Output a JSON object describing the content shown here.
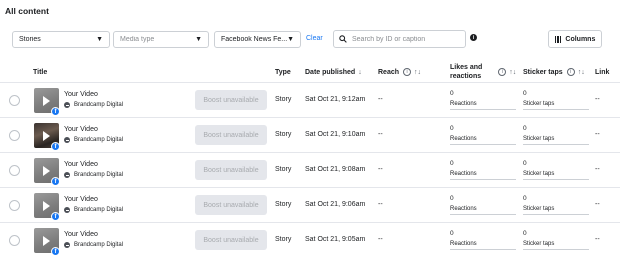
{
  "page": {
    "title": "All content"
  },
  "filters": {
    "type_select": "Stories",
    "media_type_placeholder": "Media type",
    "platform_select": "Facebook News Fe...",
    "clear_label": "Clear",
    "search_placeholder": "Search by ID or caption",
    "info_label": "i",
    "columns_label": "Columns"
  },
  "table": {
    "headers": {
      "title": "Title",
      "type": "Type",
      "date_published": "Date published",
      "date_sort": "↓",
      "reach": "Reach",
      "likes_reactions_line1": "Likes and",
      "likes_reactions_line2": "reactions",
      "sticker_taps": "Sticker taps",
      "link": "Link",
      "sort_glyph": "↑↓",
      "info_glyph": "i"
    },
    "rows": [
      {
        "title": "Your Video",
        "page": "Brandcamp Digital",
        "thumb": "gray",
        "boost": "Boost unavailable",
        "type": "Story",
        "date": "Sat Oct 21, 9:12am",
        "reach": "--",
        "reactions": "0",
        "reactions_label": "Reactions",
        "sticker_taps": "0",
        "sticker_label": "Sticker taps",
        "link": "--"
      },
      {
        "title": "Your Video",
        "page": "Brandcamp Digital",
        "thumb": "dark",
        "boost": "Boost unavailable",
        "type": "Story",
        "date": "Sat Oct 21, 9:10am",
        "reach": "--",
        "reactions": "0",
        "reactions_label": "Reactions",
        "sticker_taps": "0",
        "sticker_label": "Sticker taps",
        "link": "--"
      },
      {
        "title": "Your Video",
        "page": "Brandcamp Digital",
        "thumb": "gray",
        "boost": "Boost unavailable",
        "type": "Story",
        "date": "Sat Oct 21, 9:08am",
        "reach": "--",
        "reactions": "0",
        "reactions_label": "Reactions",
        "sticker_taps": "0",
        "sticker_label": "Sticker taps",
        "link": "--"
      },
      {
        "title": "Your Video",
        "page": "Brandcamp Digital",
        "thumb": "gray",
        "boost": "Boost unavailable",
        "type": "Story",
        "date": "Sat Oct 21, 9:06am",
        "reach": "--",
        "reactions": "0",
        "reactions_label": "Reactions",
        "sticker_taps": "0",
        "sticker_label": "Sticker taps",
        "link": "--"
      },
      {
        "title": "Your Video",
        "page": "Brandcamp Digital",
        "thumb": "gray",
        "boost": "Boost unavailable",
        "type": "Story",
        "date": "Sat Oct 21, 9:05am",
        "reach": "--",
        "reactions": "0",
        "reactions_label": "Reactions",
        "sticker_taps": "0",
        "sticker_label": "Sticker taps",
        "link": "--"
      }
    ]
  },
  "colors": {
    "accent": "#1877f2",
    "divider": "#e4e6eb",
    "disabled_bg": "#e4e6eb",
    "disabled_text": "#a8abaf"
  },
  "icons": {
    "search": "search-icon",
    "columns": "columns-icon",
    "facebook": "facebook-icon",
    "play": "play-icon",
    "page": "page-avatar-icon"
  }
}
